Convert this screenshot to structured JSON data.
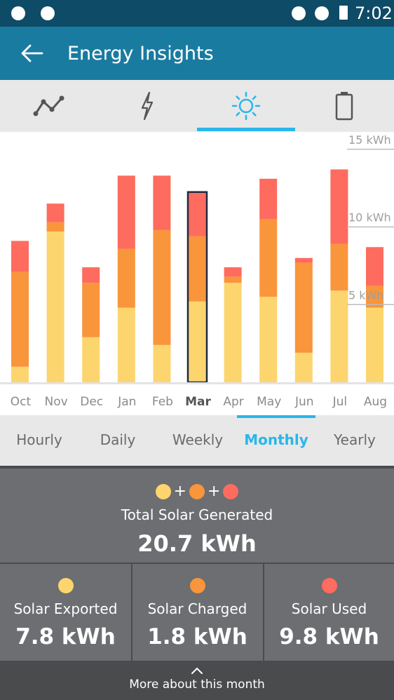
{
  "status_bar": {
    "time": "7:02"
  },
  "app_bar": {
    "title": "Energy Insights",
    "back_icon": "arrow-left-icon"
  },
  "tabs": [
    {
      "icon": "line-chart-icon",
      "active": false
    },
    {
      "icon": "lightning-icon",
      "active": false
    },
    {
      "icon": "sun-icon",
      "active": true
    },
    {
      "icon": "battery-icon",
      "active": false
    }
  ],
  "colors": {
    "exported": "#fdd56e",
    "charged": "#f9953b",
    "used": "#fe6b5f",
    "accent": "#29b6ea",
    "app_bar": "#1a7ba0",
    "status_bar": "#0e4b66"
  },
  "chart_data": {
    "type": "bar",
    "stacked": true,
    "categories": [
      "Oct",
      "Nov",
      "Dec",
      "Jan",
      "Feb",
      "Mar",
      "Apr",
      "May",
      "Jun",
      "Jul",
      "Aug"
    ],
    "selected": "Mar",
    "series": [
      {
        "key": "exported",
        "values": [
          1.0,
          9.7,
          2.9,
          4.8,
          2.4,
          5.2,
          6.4,
          5.5,
          1.9,
          5.9,
          4.8
        ]
      },
      {
        "key": "charged",
        "values": [
          6.1,
          0.6,
          3.5,
          3.8,
          7.4,
          4.2,
          0.4,
          5.0,
          5.8,
          3.0,
          1.4
        ]
      },
      {
        "key": "used",
        "values": [
          2.0,
          1.2,
          1.0,
          4.7,
          3.5,
          2.8,
          0.6,
          2.6,
          0.3,
          4.8,
          2.5
        ]
      }
    ],
    "y_ticks": [
      {
        "value": 5,
        "label": "5 kWh"
      },
      {
        "value": 10,
        "label": "10 kWh"
      },
      {
        "value": 15,
        "label": "15 kWh"
      }
    ],
    "ylim": [
      0,
      15.5
    ]
  },
  "periods": {
    "items": [
      "Hourly",
      "Daily",
      "Weekly",
      "Monthly",
      "Yearly"
    ],
    "active": "Monthly"
  },
  "summary": {
    "plus": "+",
    "label": "Total Solar Generated",
    "value": "20.7 kWh"
  },
  "stats": [
    {
      "label": "Solar Exported",
      "value": "7.8 kWh"
    },
    {
      "label": "Solar Charged",
      "value": "1.8 kWh"
    },
    {
      "label": "Solar Used",
      "value": "9.8 kWh"
    }
  ],
  "more": {
    "label": "More about this month"
  }
}
